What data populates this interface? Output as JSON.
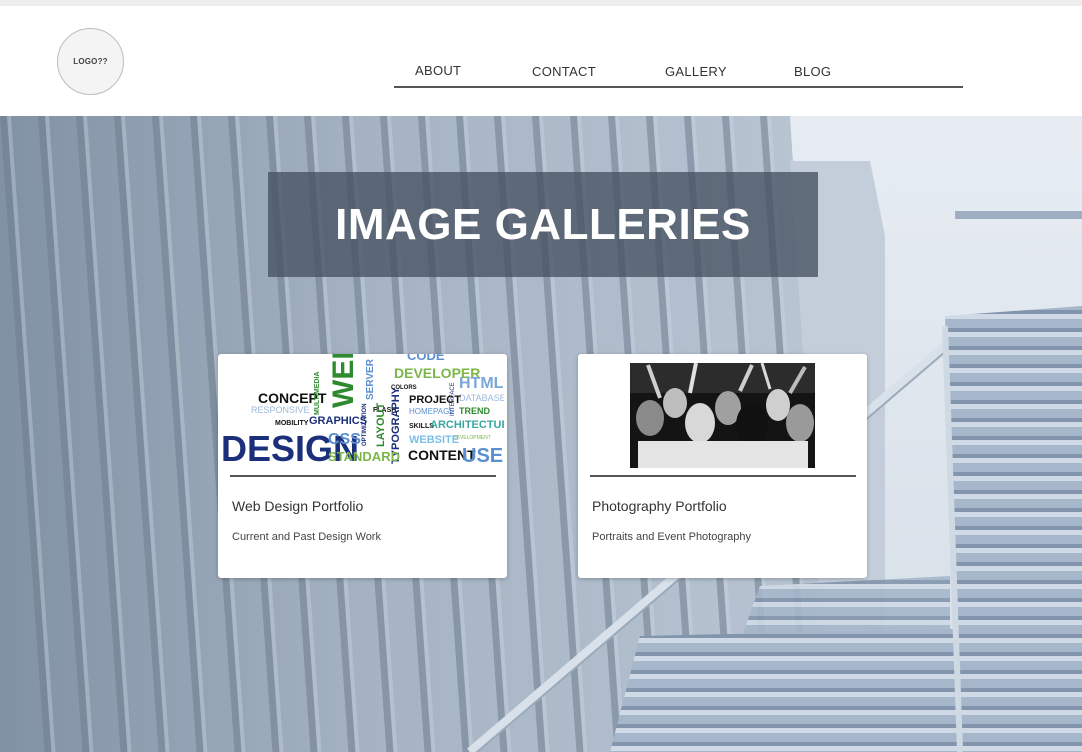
{
  "header": {
    "logo_text": "LOGO??",
    "nav": [
      {
        "label": "ABOUT"
      },
      {
        "label": "CONTACT"
      },
      {
        "label": "GALLERY"
      },
      {
        "label": "BLOG"
      }
    ]
  },
  "hero": {
    "title": "IMAGE GALLERIES"
  },
  "cards": [
    {
      "title": "Web Design Portfolio",
      "subtitle": "Current and Past Design Work",
      "image_words": [
        "CODE",
        "DEVELOPER",
        "HTML",
        "CONCEPT",
        "RESPONSIVE",
        "MULTIMEDIA",
        "WEB",
        "SERVER",
        "COLORS",
        "DATABASE",
        "PROJECT",
        "MOBILITY",
        "GRAPHICS",
        "OPTIMIZATION",
        "FLASH",
        "HOMEPAGE",
        "INTERFACE",
        "TREND",
        "LAYOUT",
        "TYPOGRAPHY",
        "SKILLS",
        "ARCHITECTURE",
        "DESIGN",
        "CSS",
        "WEBSITE",
        "DEVELOPMENT",
        "STANDARD",
        "CONTENT",
        "USER"
      ]
    },
    {
      "title": "Photography Portfolio",
      "subtitle": "Portraits and Event Photography"
    }
  ],
  "colors": {
    "word_dark": "#1b2f7a",
    "word_green": "#2f8a2f",
    "word_lightblue": "#5b8fd0",
    "word_black": "#111111",
    "word_teal": "#3aa6a0"
  }
}
